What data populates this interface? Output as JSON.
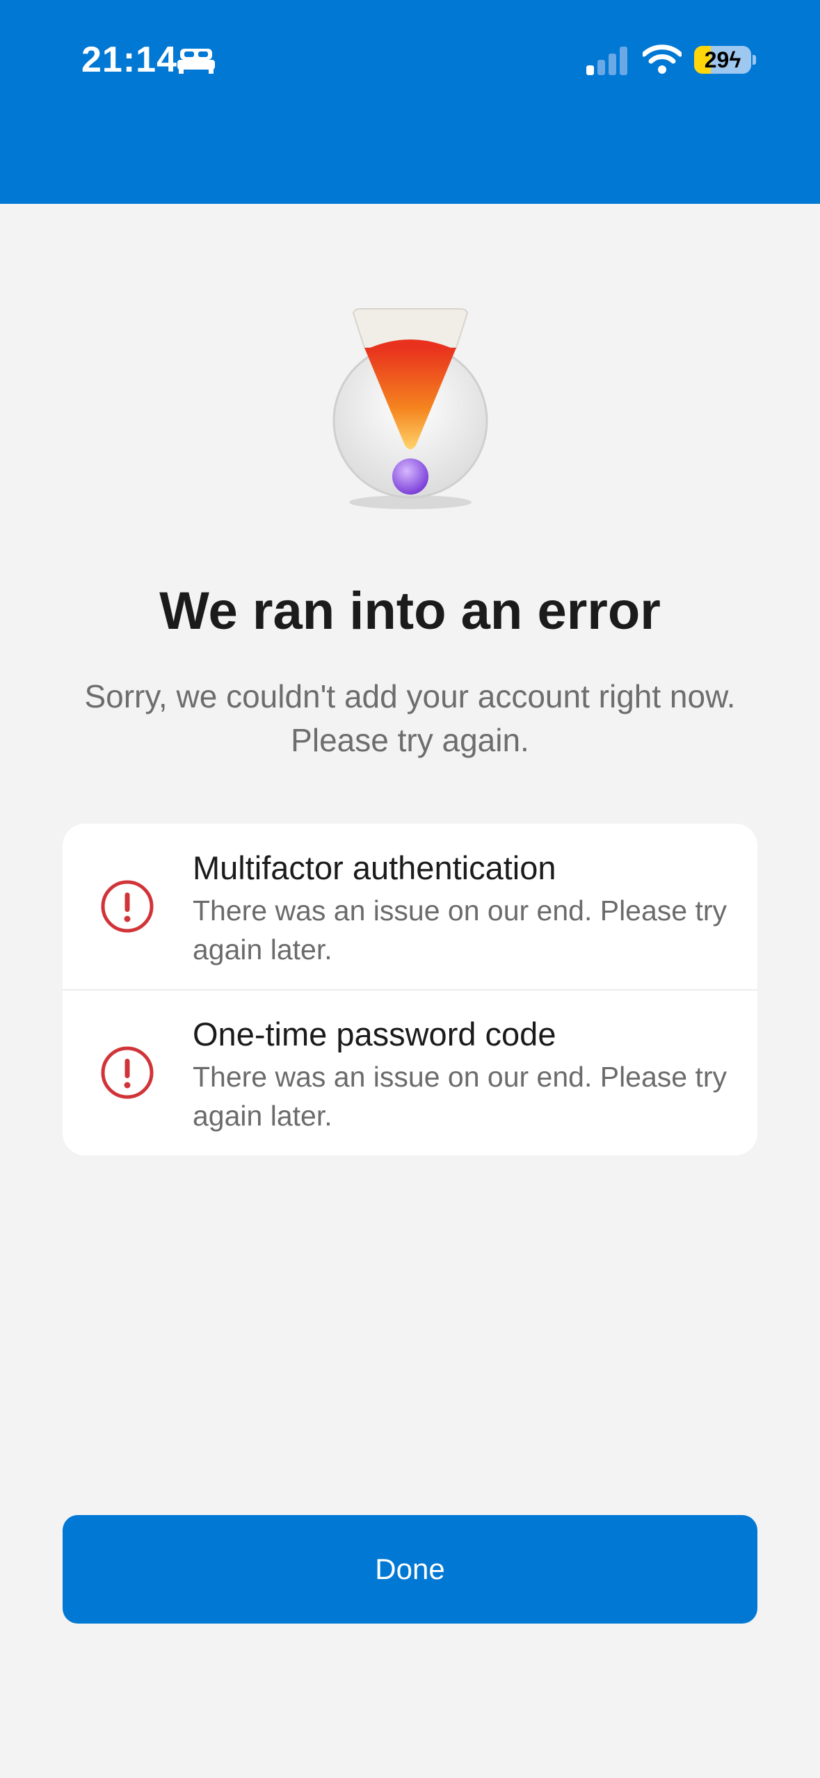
{
  "status_bar": {
    "time": "21:14",
    "battery_level": "29",
    "icons": [
      "bed-icon",
      "cellular-signal-icon",
      "wifi-icon",
      "battery-charging-icon"
    ]
  },
  "colors": {
    "brand_blue": "#0078d4",
    "error_red": "#d13438",
    "background": "#f3f3f3"
  },
  "hero": {
    "icon": "exclamation-illustration-icon"
  },
  "main": {
    "title": "We ran into an error",
    "subtitle": "Sorry, we couldn't add your account right now. Please try again."
  },
  "errors": [
    {
      "title": "Multifactor authentication",
      "description": "There was an issue on our end. Please try again later.",
      "icon": "alert-circle-icon"
    },
    {
      "title": "One-time password code",
      "description": "There was an issue on our end. Please try again later.",
      "icon": "alert-circle-icon"
    }
  ],
  "actions": {
    "done_label": "Done"
  }
}
